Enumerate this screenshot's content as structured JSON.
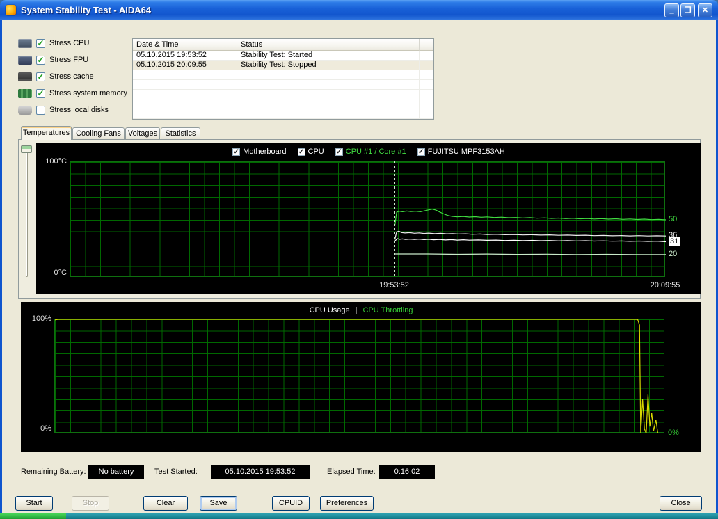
{
  "window": {
    "title": "System Stability Test - AIDA64",
    "controls": {
      "minimize": "_",
      "restore": "❐",
      "close": "✕"
    }
  },
  "stress_options": [
    {
      "label": "Stress CPU",
      "checked": true
    },
    {
      "label": "Stress FPU",
      "checked": true
    },
    {
      "label": "Stress cache",
      "checked": true
    },
    {
      "label": "Stress system memory",
      "checked": true
    },
    {
      "label": "Stress local disks",
      "checked": false
    }
  ],
  "log_table": {
    "columns": [
      "Date & Time",
      "Status"
    ],
    "rows": [
      {
        "datetime": "05.10.2015 19:53:52",
        "status": "Stability Test: Started",
        "highlighted": false
      },
      {
        "datetime": "05.10.2015 20:09:55",
        "status": "Stability Test: Stopped",
        "highlighted": true
      }
    ]
  },
  "tabs": [
    {
      "label": "Temperatures",
      "active": true
    },
    {
      "label": "Cooling Fans",
      "active": false
    },
    {
      "label": "Voltages",
      "active": false
    },
    {
      "label": "Statistics",
      "active": false
    }
  ],
  "chart_data": [
    {
      "id": "temperature",
      "type": "line",
      "ylim": [
        0,
        100
      ],
      "y_axis_top": "100°C",
      "y_axis_bottom": "0°C",
      "grid": true,
      "event_line_frac": 0.545,
      "x_labels": [
        {
          "text": "19:53:52",
          "frac": 0.545
        },
        {
          "text": "20:09:55",
          "frac": 1.0
        }
      ],
      "series": [
        {
          "name": "Motherboard",
          "checked": true,
          "color": "#FFFFFF",
          "label_color": "#FFFFFF",
          "current": "31",
          "current_boxed": true,
          "points": [
            [
              0.545,
              31.5
            ],
            [
              0.549,
              33.8
            ],
            [
              0.553,
              33.2
            ],
            [
              0.558,
              33.5
            ],
            [
              0.563,
              33.0
            ],
            [
              0.57,
              33.3
            ],
            [
              0.578,
              33.0
            ],
            [
              0.586,
              33.4
            ],
            [
              0.594,
              32.9
            ],
            [
              0.602,
              33.2
            ],
            [
              0.61,
              32.8
            ],
            [
              0.62,
              33.0
            ],
            [
              0.63,
              32.6
            ],
            [
              0.64,
              32.9
            ],
            [
              0.65,
              32.5
            ],
            [
              0.66,
              32.8
            ],
            [
              0.67,
              32.4
            ],
            [
              0.685,
              32.6
            ],
            [
              0.7,
              32.3
            ],
            [
              0.715,
              32.5
            ],
            [
              0.73,
              32.1
            ],
            [
              0.745,
              32.3
            ],
            [
              0.76,
              32.0
            ],
            [
              0.775,
              32.2
            ],
            [
              0.79,
              31.9
            ],
            [
              0.805,
              32.1
            ],
            [
              0.82,
              31.8
            ],
            [
              0.835,
              32.0
            ],
            [
              0.85,
              31.7
            ],
            [
              0.865,
              31.9
            ],
            [
              0.88,
              31.6
            ],
            [
              0.895,
              31.8
            ],
            [
              0.91,
              31.5
            ],
            [
              0.925,
              31.7
            ],
            [
              0.94,
              31.4
            ],
            [
              0.955,
              31.6
            ],
            [
              0.97,
              31.3
            ],
            [
              0.985,
              31.5
            ],
            [
              1.0,
              31.0
            ]
          ]
        },
        {
          "name": "CPU",
          "checked": true,
          "color": "#EDEDED",
          "label_color": "#FFFFFF",
          "current": "36",
          "current_boxed": false,
          "points": [
            [
              0.545,
              33.0
            ],
            [
              0.548,
              39.5
            ],
            [
              0.552,
              40.2
            ],
            [
              0.556,
              39.0
            ],
            [
              0.562,
              38.6
            ],
            [
              0.57,
              38.9
            ],
            [
              0.578,
              38.4
            ],
            [
              0.586,
              38.7
            ],
            [
              0.594,
              38.2
            ],
            [
              0.602,
              38.5
            ],
            [
              0.612,
              38.0
            ],
            [
              0.622,
              38.3
            ],
            [
              0.632,
              37.9
            ],
            [
              0.642,
              38.1
            ],
            [
              0.652,
              37.7
            ],
            [
              0.664,
              37.9
            ],
            [
              0.676,
              37.5
            ],
            [
              0.688,
              37.7
            ],
            [
              0.7,
              37.3
            ],
            [
              0.715,
              37.5
            ],
            [
              0.73,
              37.1
            ],
            [
              0.745,
              37.3
            ],
            [
              0.76,
              36.9
            ],
            [
              0.775,
              37.1
            ],
            [
              0.79,
              36.8
            ],
            [
              0.805,
              37.0
            ],
            [
              0.82,
              36.6
            ],
            [
              0.835,
              36.8
            ],
            [
              0.85,
              36.5
            ],
            [
              0.865,
              36.7
            ],
            [
              0.88,
              36.3
            ],
            [
              0.895,
              36.5
            ],
            [
              0.91,
              36.2
            ],
            [
              0.925,
              36.4
            ],
            [
              0.94,
              36.1
            ],
            [
              0.955,
              36.3
            ],
            [
              0.97,
              36.0
            ],
            [
              0.985,
              36.2
            ],
            [
              1.0,
              36.0
            ]
          ]
        },
        {
          "name": "CPU #1 / Core #1",
          "checked": true,
          "color": "#41DD41",
          "label_color": "#41DD41",
          "current": "50",
          "current_boxed": false,
          "points": [
            [
              0.545,
              45.0
            ],
            [
              0.548,
              56.5
            ],
            [
              0.552,
              57.5
            ],
            [
              0.558,
              57.0
            ],
            [
              0.565,
              57.6
            ],
            [
              0.572,
              57.1
            ],
            [
              0.58,
              57.4
            ],
            [
              0.588,
              57.0
            ],
            [
              0.595,
              57.8
            ],
            [
              0.602,
              58.6
            ],
            [
              0.608,
              59.2
            ],
            [
              0.614,
              58.4
            ],
            [
              0.62,
              56.8
            ],
            [
              0.627,
              55.2
            ],
            [
              0.634,
              53.8
            ],
            [
              0.641,
              53.0
            ],
            [
              0.65,
              52.6
            ],
            [
              0.66,
              52.9
            ],
            [
              0.67,
              52.4
            ],
            [
              0.68,
              52.7
            ],
            [
              0.69,
              52.2
            ],
            [
              0.7,
              52.5
            ],
            [
              0.712,
              52.0
            ],
            [
              0.724,
              52.3
            ],
            [
              0.736,
              51.8
            ],
            [
              0.748,
              52.0
            ],
            [
              0.76,
              51.6
            ],
            [
              0.772,
              51.9
            ],
            [
              0.784,
              51.4
            ],
            [
              0.796,
              51.7
            ],
            [
              0.808,
              51.2
            ],
            [
              0.82,
              51.5
            ],
            [
              0.832,
              51.0
            ],
            [
              0.844,
              51.3
            ],
            [
              0.856,
              50.9
            ],
            [
              0.868,
              51.1
            ],
            [
              0.88,
              50.7
            ],
            [
              0.892,
              51.0
            ],
            [
              0.904,
              50.6
            ],
            [
              0.916,
              50.9
            ],
            [
              0.928,
              50.4
            ],
            [
              0.94,
              50.7
            ],
            [
              0.952,
              50.3
            ],
            [
              0.964,
              50.6
            ],
            [
              0.976,
              50.2
            ],
            [
              0.988,
              50.4
            ],
            [
              1.0,
              50.0
            ]
          ]
        },
        {
          "name": "FUJITSU MPF3153AH",
          "checked": true,
          "color": "#C9E9C9",
          "label_color": "#FFFFFF",
          "current": "20",
          "current_boxed": false,
          "points": [
            [
              0.545,
              20.5
            ],
            [
              0.6,
              20.5
            ],
            [
              0.65,
              20.2
            ],
            [
              0.7,
              20.4
            ],
            [
              0.75,
              20.1
            ],
            [
              0.8,
              20.3
            ],
            [
              0.85,
              20.0
            ],
            [
              0.9,
              20.2
            ],
            [
              0.95,
              20.0
            ],
            [
              1.0,
              20.0
            ]
          ]
        }
      ]
    },
    {
      "id": "cpu-usage",
      "type": "line",
      "ylim": [
        0,
        100
      ],
      "y_axis_top": "100%",
      "y_axis_bottom": "0%",
      "grid": true,
      "title_parts": [
        {
          "text": "CPU Usage",
          "color": "#FFFFFF"
        },
        {
          "text": "|",
          "color": "#E0E0E0"
        },
        {
          "text": "CPU Throttling",
          "color": "#35C835"
        }
      ],
      "series": [
        {
          "name": "CPU Usage",
          "color": "#D8D800",
          "current": null,
          "points": [
            [
              0.0,
              99.5
            ],
            [
              0.005,
              100
            ],
            [
              0.955,
              100
            ],
            [
              0.958,
              95
            ],
            [
              0.96,
              0
            ],
            [
              0.963,
              30
            ],
            [
              0.966,
              4
            ],
            [
              0.969,
              0
            ],
            [
              0.972,
              34
            ],
            [
              0.975,
              6
            ],
            [
              0.978,
              18
            ],
            [
              0.981,
              2
            ],
            [
              0.985,
              12
            ],
            [
              0.988,
              0
            ],
            [
              1.0,
              0
            ]
          ]
        },
        {
          "name": "CPU Throttling",
          "color": "#35C835",
          "current": "0%",
          "current_boxed": false,
          "points": [
            [
              0.0,
              0
            ],
            [
              1.0,
              0
            ]
          ]
        }
      ]
    }
  ],
  "status_bar": {
    "battery_label": "Remaining Battery:",
    "battery_value": "No battery",
    "started_label": "Test Started:",
    "started_value": "05.10.2015 19:53:52",
    "elapsed_label": "Elapsed Time:",
    "elapsed_value": "0:16:02"
  },
  "buttons": {
    "start": "Start",
    "stop": "Stop",
    "clear": "Clear",
    "save": "Save",
    "cpuid": "CPUID",
    "preferences": "Preferences",
    "close": "Close"
  },
  "colors": {
    "titlebar_blue": "#1961D8",
    "client_bg": "#ECE9D8",
    "chart_bg": "#000000",
    "chart_grid_green": "#006E00",
    "usage_line_yellow": "#D8D800",
    "core_temp_green": "#41DD41"
  }
}
